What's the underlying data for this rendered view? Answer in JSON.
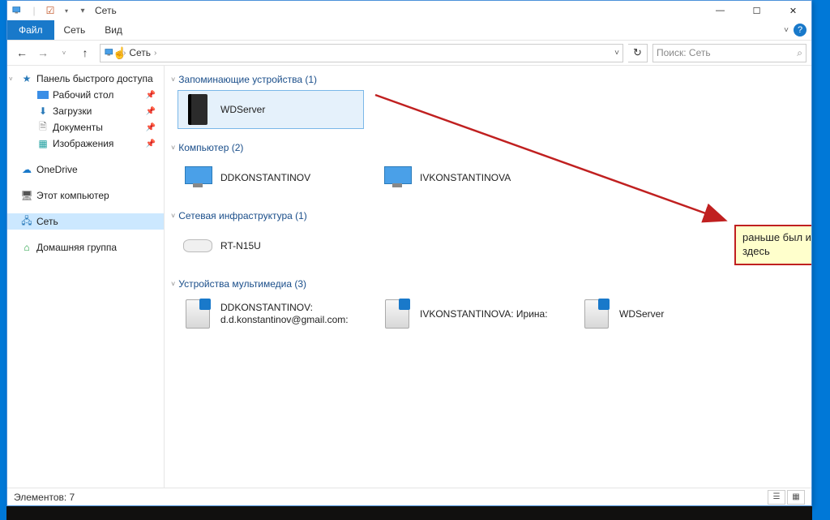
{
  "window": {
    "title": "Сеть"
  },
  "qat": {
    "dropdown": "▾"
  },
  "win_controls": {
    "min": "—",
    "max": "☐",
    "close": "✕"
  },
  "ribbon": {
    "file": "Файл",
    "tabs": [
      "Сеть",
      "Вид"
    ],
    "expand": "˅",
    "help": "?"
  },
  "nav_btn": {
    "back": "←",
    "fwd": "→",
    "recent": "˅",
    "up": "↑"
  },
  "address": {
    "crumb": "Сеть",
    "sep": "›",
    "dd": "˅"
  },
  "refresh": "↻",
  "search": {
    "placeholder": "Поиск: Сеть",
    "icon": "⌕"
  },
  "sidebar": {
    "quick": "Панель быстрого доступа",
    "desktop": "Рабочий стол",
    "downloads": "Загрузки",
    "documents": "Документы",
    "pictures": "Изображения",
    "onedrive": "OneDrive",
    "thispc": "Этот компьютер",
    "network": "Сеть",
    "homegroup": "Домашняя группа",
    "pin": "📌"
  },
  "groups": {
    "storage": {
      "title": "Запоминающие устройства (1)",
      "items": [
        "WDServer"
      ]
    },
    "computer": {
      "title": "Компьютер (2)",
      "items": [
        "DDKONSTANTINOV",
        "IVKONSTANTINOVA"
      ]
    },
    "infra": {
      "title": "Сетевая инфраструктура (1)",
      "items": [
        "RT-N15U"
      ]
    },
    "media": {
      "title": "Устройства мультимедиа (3)",
      "items": [
        "DDKONSTANTINOV: d.d.konstantinov@gmail.com:",
        "IVKONSTANTINOVA: Ирина:",
        "WDServer"
      ]
    }
  },
  "annotation": {
    "text": "раньше был и здесь"
  },
  "status": {
    "elements": "Элементов: 7"
  },
  "caret": "˅"
}
